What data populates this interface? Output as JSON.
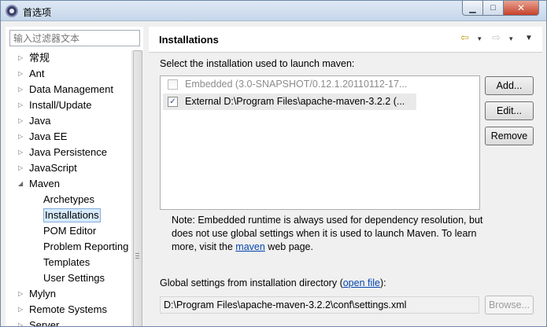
{
  "window": {
    "title": "首选项",
    "controls": {
      "minimize": "▁",
      "maximize": "□",
      "close": "✕"
    }
  },
  "sidebar": {
    "filter_placeholder": "输入过滤器文本",
    "items": [
      {
        "label": "常规",
        "level": 0,
        "expanded": false
      },
      {
        "label": "Ant",
        "level": 0,
        "expanded": false
      },
      {
        "label": "Data Management",
        "level": 0,
        "expanded": false
      },
      {
        "label": "Install/Update",
        "level": 0,
        "expanded": false
      },
      {
        "label": "Java",
        "level": 0,
        "expanded": false
      },
      {
        "label": "Java EE",
        "level": 0,
        "expanded": false
      },
      {
        "label": "Java Persistence",
        "level": 0,
        "expanded": false
      },
      {
        "label": "JavaScript",
        "level": 0,
        "expanded": false
      },
      {
        "label": "Maven",
        "level": 0,
        "expanded": true
      },
      {
        "label": "Archetypes",
        "level": 1
      },
      {
        "label": "Installations",
        "level": 1,
        "selected": true
      },
      {
        "label": "POM Editor",
        "level": 1
      },
      {
        "label": "Problem Reporting",
        "level": 1
      },
      {
        "label": "Templates",
        "level": 1
      },
      {
        "label": "User Settings",
        "level": 1
      },
      {
        "label": "Mylyn",
        "level": 0,
        "expanded": false
      },
      {
        "label": "Remote Systems",
        "level": 0,
        "expanded": false
      },
      {
        "label": "Server",
        "level": 0,
        "expanded": false
      }
    ]
  },
  "page": {
    "title": "Installations",
    "nav": {
      "back_icon": "⇦",
      "dropdown_icon": "▾",
      "forward_icon": "⇨",
      "menu_icon": "▼"
    },
    "select_label": "Select the installation used to launch maven:",
    "installations": [
      {
        "label": "Embedded (3.0-SNAPSHOT/0.12.1.20110112-17...",
        "checked": false,
        "disabled": true
      },
      {
        "label": "External D:\\Program Files\\apache-maven-3.2.2 (...",
        "checked": true,
        "disabled": false
      }
    ],
    "buttons": {
      "add": "Add...",
      "edit": "Edit...",
      "remove": "Remove",
      "browse": "Browse..."
    },
    "note": {
      "before": "Note: Embedded runtime is always used for dependency resolution, but does not use global settings when it is used to launch Maven. To learn more, visit the ",
      "link": "maven",
      "after": " web page."
    },
    "global": {
      "before": "Global settings from installation directory (",
      "link": "open file",
      "after": "):",
      "path": "D:\\Program Files\\apache-maven-3.2.2\\conf\\settings.xml"
    }
  }
}
